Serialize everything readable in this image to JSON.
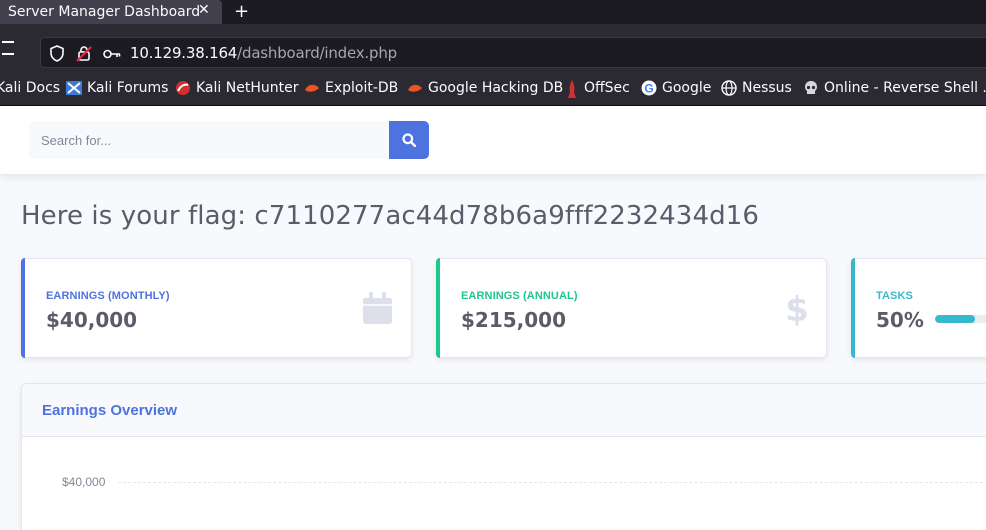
{
  "browser": {
    "tab_title": "Server Manager Dashboard",
    "tab_close": "✕",
    "new_tab": "+",
    "url_host": "10.129.38.164",
    "url_path": "/dashboard/index.php",
    "bookmarks": [
      {
        "label": "Kali Docs",
        "icon": "kali-docs-icon"
      },
      {
        "label": "Kali Forums",
        "icon": "kali-forums-icon"
      },
      {
        "label": "Kali NetHunter",
        "icon": "kali-nethunter-icon"
      },
      {
        "label": "Exploit-DB",
        "icon": "exploit-db-icon"
      },
      {
        "label": "Google Hacking DB",
        "icon": "ghdb-icon"
      },
      {
        "label": "OffSec",
        "icon": "offsec-icon"
      },
      {
        "label": "Google",
        "icon": "google-icon"
      },
      {
        "label": "Nessus",
        "icon": "globe-icon"
      },
      {
        "label": "Online - Reverse Shell ...",
        "icon": "skull-icon"
      }
    ]
  },
  "topbar": {
    "search_placeholder": "Search for..."
  },
  "main": {
    "flag_heading": "Here is your flag: c7110277ac44d78b6a9fff2232434d16",
    "cards": [
      {
        "label": "Earnings (Monthly)",
        "value": "$40,000",
        "color": "#4e73df",
        "icon": "calendar-icon"
      },
      {
        "label": "Earnings (Annual)",
        "value": "$215,000",
        "color": "#1cc88a",
        "icon": "dollar-icon"
      },
      {
        "label": "Tasks",
        "value": "50%",
        "color": "#36b9cc",
        "progress": 0.5
      }
    ],
    "chart": {
      "title": "Earnings Overview",
      "ytick_top": "$40,000"
    }
  },
  "colors": {
    "primary": "#4e73df",
    "success": "#1cc88a",
    "info": "#36b9cc",
    "text_gray": "#5a5c69"
  }
}
